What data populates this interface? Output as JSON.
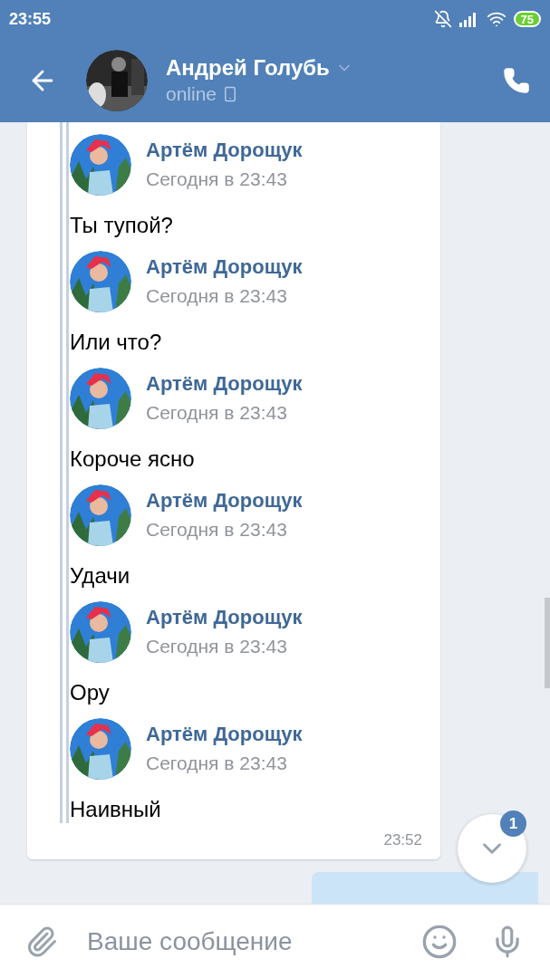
{
  "status_bar": {
    "time": "23:55",
    "battery": "75"
  },
  "header": {
    "name": "Андрей Голубь",
    "status": "online"
  },
  "forwarded": {
    "time": "23:52",
    "messages": [
      {
        "author": "Артём Дорощук",
        "date": "Сегодня в 23:43",
        "text": "Ты тупой?"
      },
      {
        "author": "Артём Дорощук",
        "date": "Сегодня в 23:43",
        "text": "Или что?"
      },
      {
        "author": "Артём Дорощук",
        "date": "Сегодня в 23:43",
        "text": "Короче ясно"
      },
      {
        "author": "Артём Дорощук",
        "date": "Сегодня в 23:43",
        "text": "Удачи"
      },
      {
        "author": "Артём Дорощук",
        "date": "Сегодня в 23:43",
        "text": "Ору"
      },
      {
        "author": "Артём Дорощук",
        "date": "Сегодня в 23:43",
        "text": "Наивный"
      }
    ]
  },
  "scroll_down": {
    "badge": "1"
  },
  "composer": {
    "placeholder": "Ваше сообщение"
  }
}
